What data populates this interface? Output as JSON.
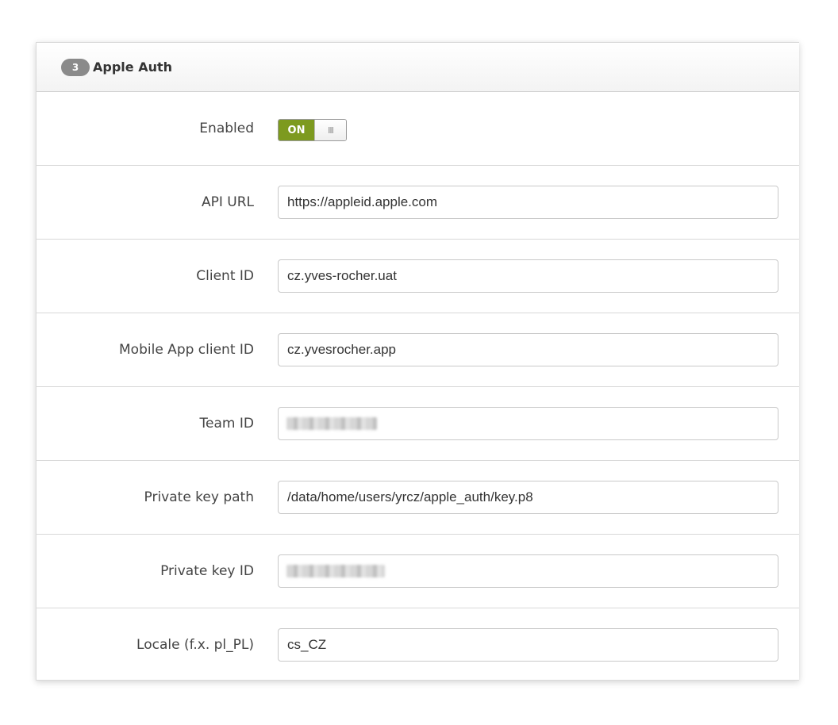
{
  "panel": {
    "step_number": "3",
    "title": "Apple Auth"
  },
  "fields": {
    "enabled": {
      "label": "Enabled",
      "toggle_on_text": "ON",
      "toggle_handle_glyph": "III",
      "state": "on"
    },
    "api_url": {
      "label": "API URL",
      "value": "https://appleid.apple.com"
    },
    "client_id": {
      "label": "Client ID",
      "value": "cz.yves-rocher.uat"
    },
    "mobile_app_client_id": {
      "label": "Mobile App client ID",
      "value": "cz.yvesrocher.app"
    },
    "team_id": {
      "label": "Team ID",
      "value_redacted": true
    },
    "private_key_path": {
      "label": "Private key path",
      "value": "/data/home/users/yrcz/apple_auth/key.p8"
    },
    "private_key_id": {
      "label": "Private key ID",
      "value_redacted": true
    },
    "locale": {
      "label": "Locale (f.x. pl_PL)",
      "value": "cs_CZ"
    }
  },
  "colors": {
    "toggle_on": "#7d9a1f",
    "badge": "#8a8a8a"
  }
}
